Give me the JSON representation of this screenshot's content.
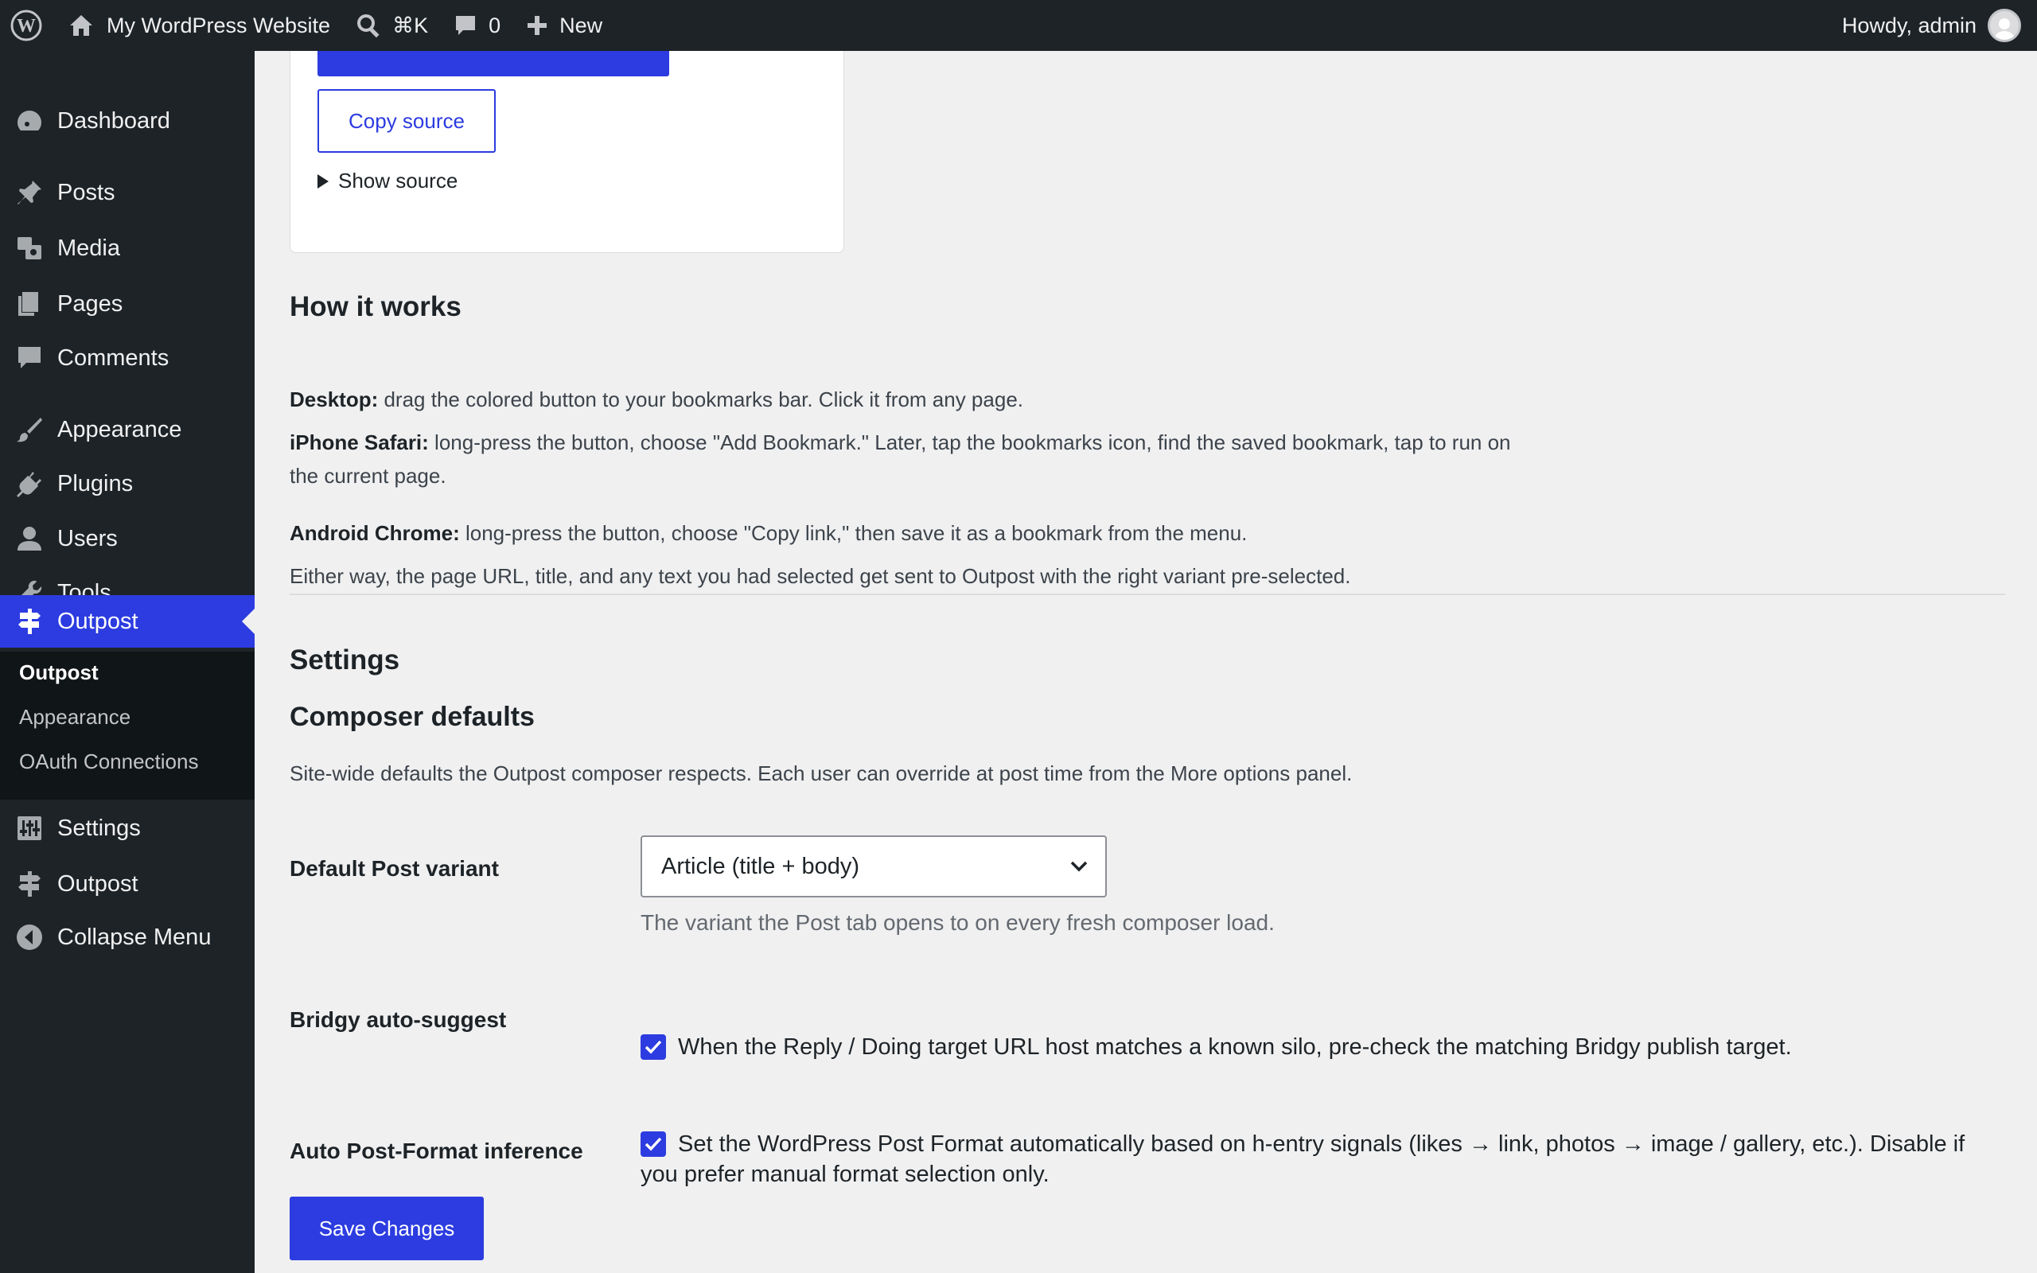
{
  "adminbar": {
    "site_name": "My WordPress Website",
    "search_shortcut": "⌘K",
    "comments_count": "0",
    "new_label": "New",
    "greeting": "Howdy, admin"
  },
  "sidebar": {
    "items": [
      {
        "label": "Dashboard"
      },
      {
        "label": "Posts"
      },
      {
        "label": "Media"
      },
      {
        "label": "Pages"
      },
      {
        "label": "Comments"
      },
      {
        "label": "Appearance"
      },
      {
        "label": "Plugins"
      },
      {
        "label": "Users"
      },
      {
        "label": "Tools"
      },
      {
        "label": "Outpost"
      },
      {
        "label": "Settings"
      },
      {
        "label": "Outpost"
      },
      {
        "label": "Collapse Menu"
      }
    ],
    "submenu": [
      {
        "label": "Outpost"
      },
      {
        "label": "Appearance"
      },
      {
        "label": "OAuth Connections"
      }
    ]
  },
  "bookmarklet": {
    "copy_label": "Copy source",
    "show_label": "Show source"
  },
  "how": {
    "heading": "How it works",
    "desktop_label": "Desktop:",
    "desktop_text": " drag the colored button to your bookmarks bar. Click it from any page.",
    "iphone_label": "iPhone Safari:",
    "iphone_text": " long-press the button, choose \"Add Bookmark.\" Later, tap the bookmarks icon, find the saved bookmark, tap to run on the current page.",
    "android_label": "Android Chrome:",
    "android_text": " long-press the button, choose \"Copy link,\" then save it as a bookmark from the menu.",
    "either": "Either way, the page URL, title, and any text you had selected get sent to Outpost with the right variant pre-selected."
  },
  "settings": {
    "heading": "Settings",
    "subheading": "Composer defaults",
    "intro": "Site-wide defaults the Outpost composer respects. Each user can override at post time from the More options panel.",
    "variant_label": "Default Post variant",
    "variant_value": "Article (title + body)",
    "variant_desc": "The variant the Post tab opens to on every fresh composer load.",
    "bridgy_label": "Bridgy auto-suggest",
    "bridgy_text": "When the Reply / Doing target URL host matches a known silo, pre-check the matching Bridgy publish target.",
    "format_label": "Auto Post-Format inference",
    "format_text": "Set the WordPress Post Format automatically based on h-entry signals (likes → link, photos → image / gallery, etc.). Disable if you prefer manual format selection only.",
    "save_label": "Save Changes"
  },
  "colors": {
    "accent": "#2c3ce0",
    "adminbar": "#1d2327",
    "background": "#f0f0f1"
  }
}
